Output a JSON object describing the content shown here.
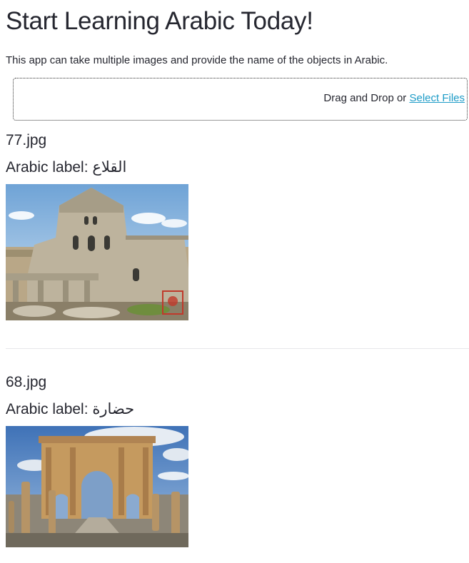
{
  "title": "Start Learning Arabic Today!",
  "intro": "This app can take multiple images and provide the name of the objects in Arabic.",
  "upload": {
    "prompt": "Drag and Drop or ",
    "link_label": "Select Files"
  },
  "results": [
    {
      "filename": "77.jpg",
      "label_prefix": "Arabic label: ",
      "label_value": "القلاع"
    },
    {
      "filename": "68.jpg",
      "label_prefix": "Arabic label: ",
      "label_value": "حضارة"
    }
  ]
}
